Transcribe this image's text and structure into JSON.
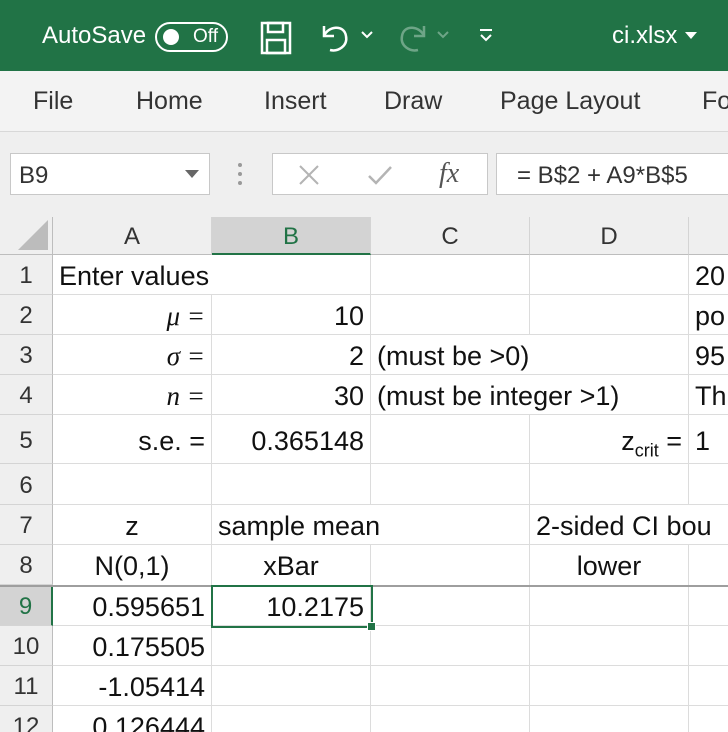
{
  "titlebar": {
    "autosave_label": "AutoSave",
    "toggle_state": "Off",
    "filename": "ci.xlsx"
  },
  "ribbon": {
    "tabs": [
      "File",
      "Home",
      "Insert",
      "Draw",
      "Page Layout",
      "Fo"
    ]
  },
  "formula_bar": {
    "name_box": "B9",
    "formula": "= B$2 + A9*B$5"
  },
  "columns": [
    "A",
    "B",
    "C",
    "D"
  ],
  "selected_column": "B",
  "selected_row": "9",
  "rows": [
    "1",
    "2",
    "3",
    "4",
    "5",
    "6",
    "7",
    "8",
    "9",
    "10",
    "11",
    "12"
  ],
  "cells": {
    "A1": "Enter values",
    "E1": "20",
    "A2": "μ =",
    "B2": "10",
    "E2": "po",
    "A3": "σ =",
    "B3": "2",
    "C3": "(must be >0)",
    "E3": "95",
    "A4": "n =",
    "B4": "30",
    "C4": "(must be integer >1)",
    "E4": "Th",
    "A5": "s.e. =",
    "B5": "0.365148",
    "D5_z": "z",
    "D5_sub": "crit",
    "D5_eq": " =",
    "E5": "1",
    "A7": "z",
    "B7": "sample mean",
    "D7": "2-sided CI bou",
    "A8": "N(0,1)",
    "B8": "xBar",
    "D8": "lower",
    "A9": "0.595651",
    "B9": "10.2175",
    "A10": "0.175505",
    "A11": "-1.05414",
    "A12": "0.126444"
  },
  "colors": {
    "excel_green": "#217346"
  }
}
